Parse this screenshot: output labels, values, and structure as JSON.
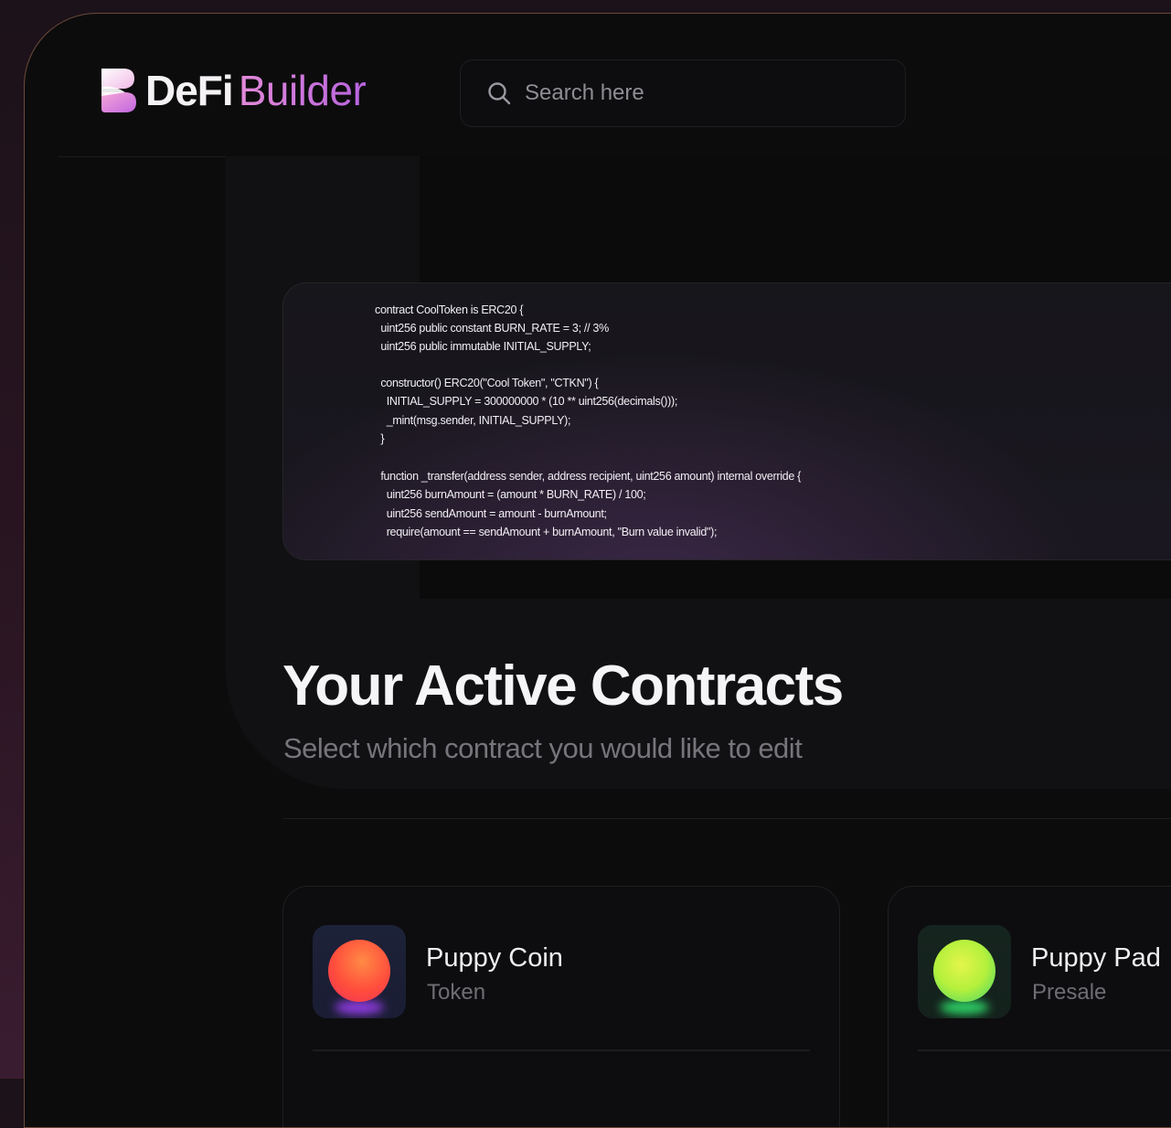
{
  "brand": {
    "name_part1": "DeFi",
    "name_part2": "Builder"
  },
  "search": {
    "placeholder": "Search here"
  },
  "code": {
    "lines": [
      "contract CoolToken is ERC20 {",
      "  uint256 public constant BURN_RATE = 3; // 3%",
      "  uint256 public immutable INITIAL_SUPPLY;",
      "",
      "  constructor() ERC20(\"Cool Token\", \"CTKN\") {",
      "    INITIAL_SUPPLY = 300000000 * (10 ** uint256(decimals()));",
      "    _mint(msg.sender, INITIAL_SUPPLY);",
      "  }",
      "",
      "  function _transfer(address sender, address recipient, uint256 amount) internal override {",
      "    uint256 burnAmount = (amount * BURN_RATE) / 100;",
      "    uint256 sendAmount = amount - burnAmount;",
      "    require(amount == sendAmount + burnAmount, \"Burn value invalid\");"
    ]
  },
  "contracts_section": {
    "title": "Your Active Contracts",
    "subtitle": "Select which contract you would like to edit"
  },
  "contracts": [
    {
      "name": "Puppy Coin",
      "type": "Token",
      "icon": "orange-orb-icon",
      "color": "#ff5a3c"
    },
    {
      "name": "Puppy Pad",
      "type": "Presale",
      "icon": "green-orb-icon",
      "color": "#b6f23a"
    }
  ]
}
